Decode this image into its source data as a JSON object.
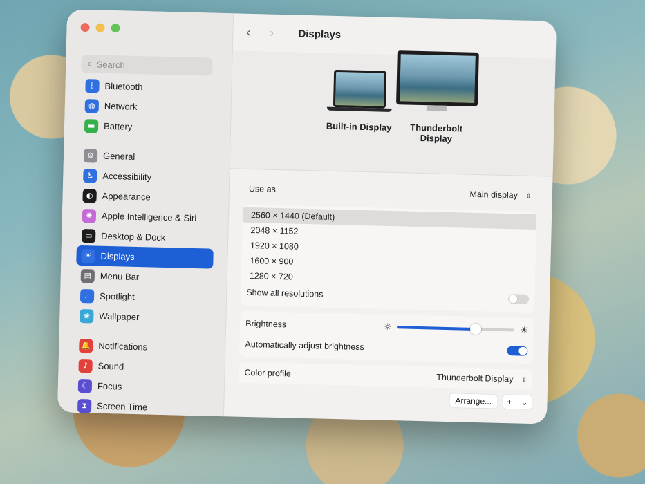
{
  "window": {
    "title": "Displays"
  },
  "sidebar": {
    "search_placeholder": "Search",
    "items": [
      {
        "label": "Bluetooth",
        "icon": "bluetooth-icon",
        "color": "#2f6fe0",
        "glyph": "ᛒ"
      },
      {
        "label": "Network",
        "icon": "network-icon",
        "color": "#2f6fe0",
        "glyph": "◍"
      },
      {
        "label": "Battery",
        "icon": "battery-icon",
        "color": "#35b14b",
        "glyph": "▬"
      },
      {
        "label": "General",
        "icon": "gear-icon",
        "color": "#8e8e93",
        "glyph": "⚙"
      },
      {
        "label": "Accessibility",
        "icon": "accessibility-icon",
        "color": "#2f6fe0",
        "glyph": "♿"
      },
      {
        "label": "Appearance",
        "icon": "appearance-icon",
        "color": "#1c1c1e",
        "glyph": "◐"
      },
      {
        "label": "Apple Intelligence & Siri",
        "icon": "siri-icon",
        "color": "#c56bd6",
        "glyph": "✺"
      },
      {
        "label": "Desktop & Dock",
        "icon": "dock-icon",
        "color": "#1c1c1e",
        "glyph": "▭"
      },
      {
        "label": "Displays",
        "icon": "displays-icon",
        "color": "#2f6fe0",
        "glyph": "☀"
      },
      {
        "label": "Menu Bar",
        "icon": "menu-bar-icon",
        "color": "#6e6e73",
        "glyph": "▤"
      },
      {
        "label": "Spotlight",
        "icon": "spotlight-icon",
        "color": "#2f6fe0",
        "glyph": "⌕"
      },
      {
        "label": "Wallpaper",
        "icon": "wallpaper-icon",
        "color": "#38a9d6",
        "glyph": "❀"
      },
      {
        "label": "Notifications",
        "icon": "notifications-icon",
        "color": "#e0413a",
        "glyph": "🔔"
      },
      {
        "label": "Sound",
        "icon": "sound-icon",
        "color": "#e0413a",
        "glyph": "♪"
      },
      {
        "label": "Focus",
        "icon": "focus-icon",
        "color": "#5a4fd1",
        "glyph": "☾"
      },
      {
        "label": "Screen Time",
        "icon": "screen-time-icon",
        "color": "#5a4fd1",
        "glyph": "⧗"
      }
    ],
    "selected": "Displays"
  },
  "displays": {
    "builtin_label": "Built-in Display",
    "external_label_line1": "Thunderbolt",
    "external_label_line2": "Display"
  },
  "settings": {
    "use_as_label": "Use as",
    "use_as_value": "Main display",
    "resolutions": [
      "2560 × 1440 (Default)",
      "2048 × 1152",
      "1920 × 1080",
      "1600 × 900",
      "1280 × 720"
    ],
    "selected_resolution": "2560 × 1440 (Default)",
    "show_all_label": "Show all resolutions",
    "show_all_on": false,
    "brightness_label": "Brightness",
    "brightness_level": 0.67,
    "auto_brightness_label": "Automatically adjust brightness",
    "auto_brightness_on": true,
    "color_profile_label": "Color profile",
    "color_profile_value": "Thunderbolt Display",
    "arrange_label": "Arrange...",
    "add_label": "+",
    "more_label": "⌄"
  },
  "colors": {
    "accent": "#1f5fd6",
    "close": "#ed6a5e",
    "minimize": "#f5bf4f",
    "zoom": "#61c554"
  }
}
